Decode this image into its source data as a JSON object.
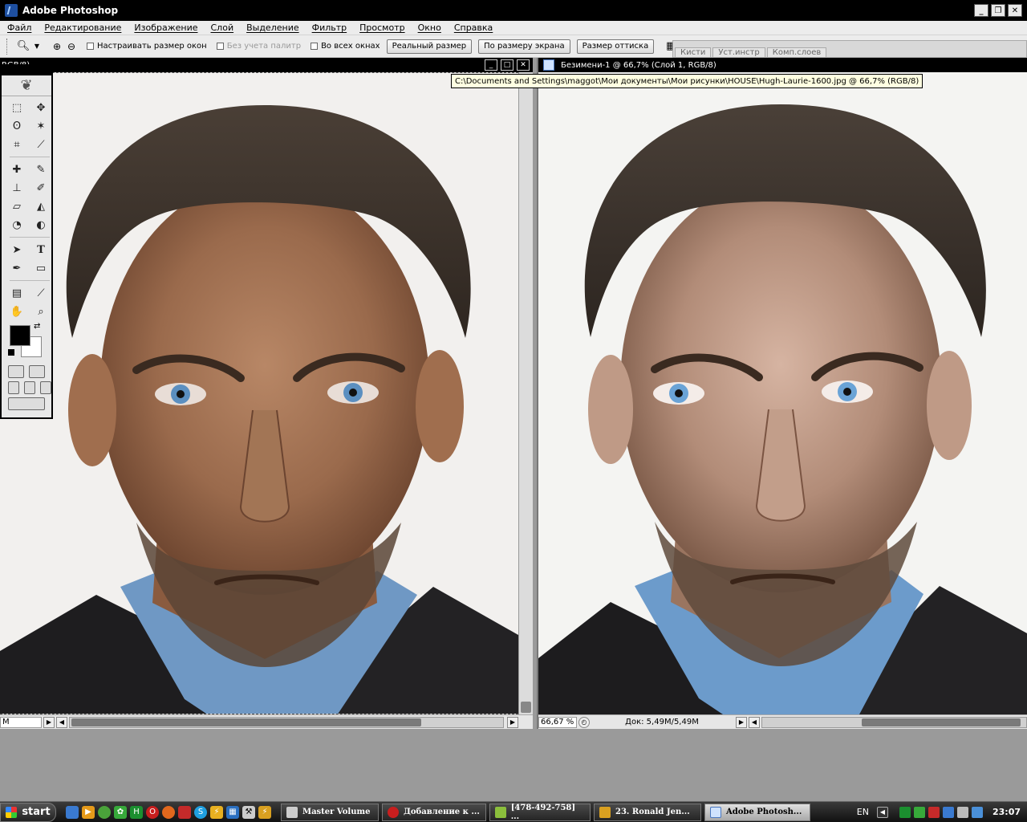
{
  "app": {
    "title": "Adobe Photoshop"
  },
  "menu": [
    "Файл",
    "Редактирование",
    "Изображение",
    "Слой",
    "Выделение",
    "Фильтр",
    "Просмотр",
    "Окно",
    "Справка"
  ],
  "options": {
    "resize_windows": "Настраивать размер окон",
    "ignore_palettes": "Без учета палитр",
    "all_windows": "Во всех окнах",
    "actual_pixels": "Реальный размер",
    "fit_screen": "По размеру экрана",
    "print_size": "Размер оттиска",
    "palette_tabs": [
      "Кисти",
      "Уст.инстр",
      "Комп.слоев"
    ]
  },
  "left_doc": {
    "title_fragment": "RGB/8)",
    "status_zoom": "M"
  },
  "right_doc": {
    "title": "Безимени-1 @ 66,7% (Слой 1, RGB/8)",
    "zoom": "66,67 %",
    "doc_size": "Док: 5,49M/5,49M"
  },
  "tooltip": "C:\\Documents and Settings\\maggot\\Мои документы\\Мои рисунки\\HOUSE\\Hugh-Laurie-1600.jpg @ 66,7% (RGB/8)",
  "colors": {
    "foreground": "#000000",
    "background": "#ffffff"
  },
  "taskbar": {
    "start": "start",
    "buttons": [
      {
        "label": "Master Volume",
        "icon": "speaker-icon",
        "active": false
      },
      {
        "label": "Добавление к ...",
        "icon": "opera-icon",
        "active": false
      },
      {
        "label": "[478-492-758] ...",
        "icon": "icq-icon",
        "active": false
      },
      {
        "label": "23. Ronald Jen...",
        "icon": "winamp-icon",
        "active": false
      },
      {
        "label": "Adobe Photosh...",
        "icon": "photoshop-icon",
        "active": true
      }
    ],
    "language": "EN",
    "clock": "23:07"
  }
}
